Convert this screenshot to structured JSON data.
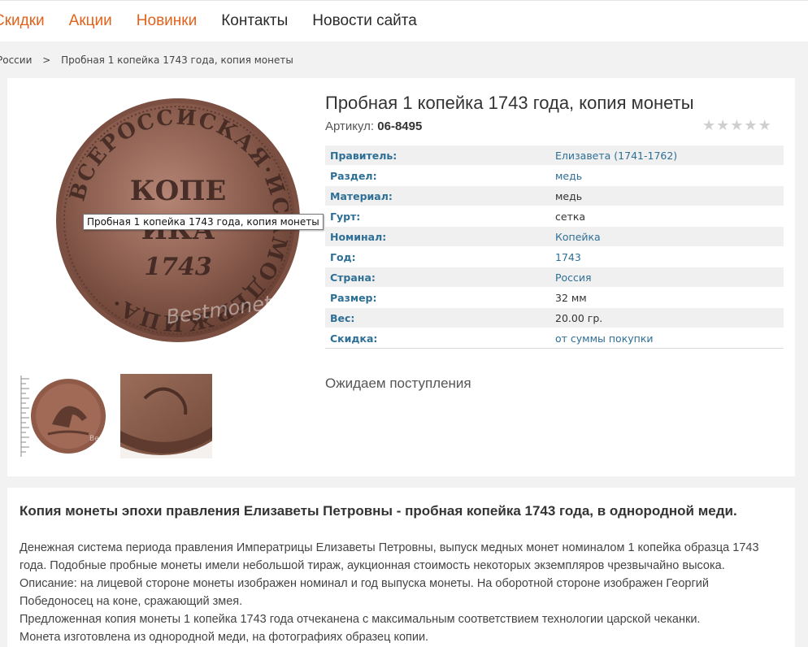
{
  "nav": {
    "items": [
      {
        "label": "Скидки",
        "color": "#e2621b"
      },
      {
        "label": "Акции",
        "color": "#e2621b"
      },
      {
        "label": "Новинки",
        "color": "#e2621b"
      },
      {
        "label": "Контакты",
        "color": "#2b2b2b"
      },
      {
        "label": "Новости сайта",
        "color": "#2b2b2b"
      }
    ]
  },
  "breadcrumb": {
    "parent": "России",
    "separator": ">",
    "current": "Пробная 1 копейка 1743 года, копия монеты"
  },
  "product": {
    "title": "Пробная 1 копейка 1743 года, копия монеты",
    "article_label": "Артикул:",
    "article_value": "06-8495",
    "rating_stars": 0,
    "rating_max": 5,
    "image_tooltip": "Пробная 1 копейка 1743 года, копия монеты",
    "coin_text": {
      "center_top": "КОПЕ",
      "center_mid": "ИКА",
      "center_year": "1743",
      "watermark": "Bestmoneta.ru"
    },
    "thumb_watermark": "Bestmoneta",
    "properties": [
      {
        "key": "Правитель:",
        "value": "Елизавета (1741-1762)",
        "link": true
      },
      {
        "key": "Раздел:",
        "value": "медь",
        "link": true
      },
      {
        "key": "Материал:",
        "value": "медь",
        "link": false
      },
      {
        "key": "Гурт:",
        "value": "сетка",
        "link": false
      },
      {
        "key": "Номинал:",
        "value": "Копейка",
        "link": true
      },
      {
        "key": "Год:",
        "value": "1743",
        "link": true
      },
      {
        "key": "Страна:",
        "value": "Россия",
        "link": true
      },
      {
        "key": "Размер:",
        "value": "32 мм",
        "link": false
      },
      {
        "key": "Вес:",
        "value": "20.00 гр.",
        "link": false
      },
      {
        "key": "Скидка:",
        "value": "от суммы покупки",
        "link": true
      }
    ],
    "availability": "Ожидаем поступления"
  },
  "description": {
    "heading": "Копия монеты эпохи правления Елизаветы Петровны - пробная копейка 1743 года, в однородной меди.",
    "paragraphs": [
      "Денежная система периода правления Императрицы Елизаветы Петровны, выпуск медных монет номиналом 1 копейка образца 1743 года. Подобные пробные монеты имели небольшой тираж, аукционная стоимость некоторых экземпляров чрезвычайно высока.",
      "Описание: на лицевой стороне монеты изображен номинал и год выпуска монеты. На оборотной стороне изображен Георгий Победоносец на коне, сражающий змея.",
      "Предложенная копия монеты 1 копейка 1743 года отчеканена с максимальным соответствием технологии царской чеканки.",
      "Монета изготовлена из однородной меди, на фотографиях образец копии."
    ]
  },
  "colors": {
    "accent_orange": "#e2621b",
    "link_blue": "#2e6f96",
    "copper": "#8a5a4a"
  }
}
